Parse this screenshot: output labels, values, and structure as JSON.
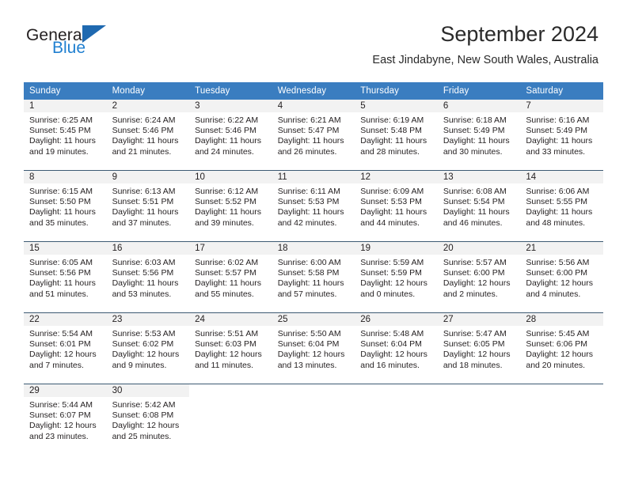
{
  "brand": {
    "name_top": "General",
    "name_bottom": "Blue",
    "triangle_color": "#1f69b0",
    "blue_color": "#1f7fd0"
  },
  "header": {
    "title": "September 2024",
    "subtitle": "East Jindabyne, New South Wales, Australia"
  },
  "calendar": {
    "header_bg": "#3a7dc0",
    "daynum_bg": "#f2f2f2",
    "weekdays": [
      "Sunday",
      "Monday",
      "Tuesday",
      "Wednesday",
      "Thursday",
      "Friday",
      "Saturday"
    ],
    "weeks": [
      [
        {
          "day": "1",
          "sunrise": "Sunrise: 6:25 AM",
          "sunset": "Sunset: 5:45 PM",
          "daylight1": "Daylight: 11 hours",
          "daylight2": "and 19 minutes."
        },
        {
          "day": "2",
          "sunrise": "Sunrise: 6:24 AM",
          "sunset": "Sunset: 5:46 PM",
          "daylight1": "Daylight: 11 hours",
          "daylight2": "and 21 minutes."
        },
        {
          "day": "3",
          "sunrise": "Sunrise: 6:22 AM",
          "sunset": "Sunset: 5:46 PM",
          "daylight1": "Daylight: 11 hours",
          "daylight2": "and 24 minutes."
        },
        {
          "day": "4",
          "sunrise": "Sunrise: 6:21 AM",
          "sunset": "Sunset: 5:47 PM",
          "daylight1": "Daylight: 11 hours",
          "daylight2": "and 26 minutes."
        },
        {
          "day": "5",
          "sunrise": "Sunrise: 6:19 AM",
          "sunset": "Sunset: 5:48 PM",
          "daylight1": "Daylight: 11 hours",
          "daylight2": "and 28 minutes."
        },
        {
          "day": "6",
          "sunrise": "Sunrise: 6:18 AM",
          "sunset": "Sunset: 5:49 PM",
          "daylight1": "Daylight: 11 hours",
          "daylight2": "and 30 minutes."
        },
        {
          "day": "7",
          "sunrise": "Sunrise: 6:16 AM",
          "sunset": "Sunset: 5:49 PM",
          "daylight1": "Daylight: 11 hours",
          "daylight2": "and 33 minutes."
        }
      ],
      [
        {
          "day": "8",
          "sunrise": "Sunrise: 6:15 AM",
          "sunset": "Sunset: 5:50 PM",
          "daylight1": "Daylight: 11 hours",
          "daylight2": "and 35 minutes."
        },
        {
          "day": "9",
          "sunrise": "Sunrise: 6:13 AM",
          "sunset": "Sunset: 5:51 PM",
          "daylight1": "Daylight: 11 hours",
          "daylight2": "and 37 minutes."
        },
        {
          "day": "10",
          "sunrise": "Sunrise: 6:12 AM",
          "sunset": "Sunset: 5:52 PM",
          "daylight1": "Daylight: 11 hours",
          "daylight2": "and 39 minutes."
        },
        {
          "day": "11",
          "sunrise": "Sunrise: 6:11 AM",
          "sunset": "Sunset: 5:53 PM",
          "daylight1": "Daylight: 11 hours",
          "daylight2": "and 42 minutes."
        },
        {
          "day": "12",
          "sunrise": "Sunrise: 6:09 AM",
          "sunset": "Sunset: 5:53 PM",
          "daylight1": "Daylight: 11 hours",
          "daylight2": "and 44 minutes."
        },
        {
          "day": "13",
          "sunrise": "Sunrise: 6:08 AM",
          "sunset": "Sunset: 5:54 PM",
          "daylight1": "Daylight: 11 hours",
          "daylight2": "and 46 minutes."
        },
        {
          "day": "14",
          "sunrise": "Sunrise: 6:06 AM",
          "sunset": "Sunset: 5:55 PM",
          "daylight1": "Daylight: 11 hours",
          "daylight2": "and 48 minutes."
        }
      ],
      [
        {
          "day": "15",
          "sunrise": "Sunrise: 6:05 AM",
          "sunset": "Sunset: 5:56 PM",
          "daylight1": "Daylight: 11 hours",
          "daylight2": "and 51 minutes."
        },
        {
          "day": "16",
          "sunrise": "Sunrise: 6:03 AM",
          "sunset": "Sunset: 5:56 PM",
          "daylight1": "Daylight: 11 hours",
          "daylight2": "and 53 minutes."
        },
        {
          "day": "17",
          "sunrise": "Sunrise: 6:02 AM",
          "sunset": "Sunset: 5:57 PM",
          "daylight1": "Daylight: 11 hours",
          "daylight2": "and 55 minutes."
        },
        {
          "day": "18",
          "sunrise": "Sunrise: 6:00 AM",
          "sunset": "Sunset: 5:58 PM",
          "daylight1": "Daylight: 11 hours",
          "daylight2": "and 57 minutes."
        },
        {
          "day": "19",
          "sunrise": "Sunrise: 5:59 AM",
          "sunset": "Sunset: 5:59 PM",
          "daylight1": "Daylight: 12 hours",
          "daylight2": "and 0 minutes."
        },
        {
          "day": "20",
          "sunrise": "Sunrise: 5:57 AM",
          "sunset": "Sunset: 6:00 PM",
          "daylight1": "Daylight: 12 hours",
          "daylight2": "and 2 minutes."
        },
        {
          "day": "21",
          "sunrise": "Sunrise: 5:56 AM",
          "sunset": "Sunset: 6:00 PM",
          "daylight1": "Daylight: 12 hours",
          "daylight2": "and 4 minutes."
        }
      ],
      [
        {
          "day": "22",
          "sunrise": "Sunrise: 5:54 AM",
          "sunset": "Sunset: 6:01 PM",
          "daylight1": "Daylight: 12 hours",
          "daylight2": "and 7 minutes."
        },
        {
          "day": "23",
          "sunrise": "Sunrise: 5:53 AM",
          "sunset": "Sunset: 6:02 PM",
          "daylight1": "Daylight: 12 hours",
          "daylight2": "and 9 minutes."
        },
        {
          "day": "24",
          "sunrise": "Sunrise: 5:51 AM",
          "sunset": "Sunset: 6:03 PM",
          "daylight1": "Daylight: 12 hours",
          "daylight2": "and 11 minutes."
        },
        {
          "day": "25",
          "sunrise": "Sunrise: 5:50 AM",
          "sunset": "Sunset: 6:04 PM",
          "daylight1": "Daylight: 12 hours",
          "daylight2": "and 13 minutes."
        },
        {
          "day": "26",
          "sunrise": "Sunrise: 5:48 AM",
          "sunset": "Sunset: 6:04 PM",
          "daylight1": "Daylight: 12 hours",
          "daylight2": "and 16 minutes."
        },
        {
          "day": "27",
          "sunrise": "Sunrise: 5:47 AM",
          "sunset": "Sunset: 6:05 PM",
          "daylight1": "Daylight: 12 hours",
          "daylight2": "and 18 minutes."
        },
        {
          "day": "28",
          "sunrise": "Sunrise: 5:45 AM",
          "sunset": "Sunset: 6:06 PM",
          "daylight1": "Daylight: 12 hours",
          "daylight2": "and 20 minutes."
        }
      ],
      [
        {
          "day": "29",
          "sunrise": "Sunrise: 5:44 AM",
          "sunset": "Sunset: 6:07 PM",
          "daylight1": "Daylight: 12 hours",
          "daylight2": "and 23 minutes."
        },
        {
          "day": "30",
          "sunrise": "Sunrise: 5:42 AM",
          "sunset": "Sunset: 6:08 PM",
          "daylight1": "Daylight: 12 hours",
          "daylight2": "and 25 minutes."
        },
        {
          "day": "",
          "sunrise": "",
          "sunset": "",
          "daylight1": "",
          "daylight2": ""
        },
        {
          "day": "",
          "sunrise": "",
          "sunset": "",
          "daylight1": "",
          "daylight2": ""
        },
        {
          "day": "",
          "sunrise": "",
          "sunset": "",
          "daylight1": "",
          "daylight2": ""
        },
        {
          "day": "",
          "sunrise": "",
          "sunset": "",
          "daylight1": "",
          "daylight2": ""
        },
        {
          "day": "",
          "sunrise": "",
          "sunset": "",
          "daylight1": "",
          "daylight2": ""
        }
      ]
    ]
  }
}
